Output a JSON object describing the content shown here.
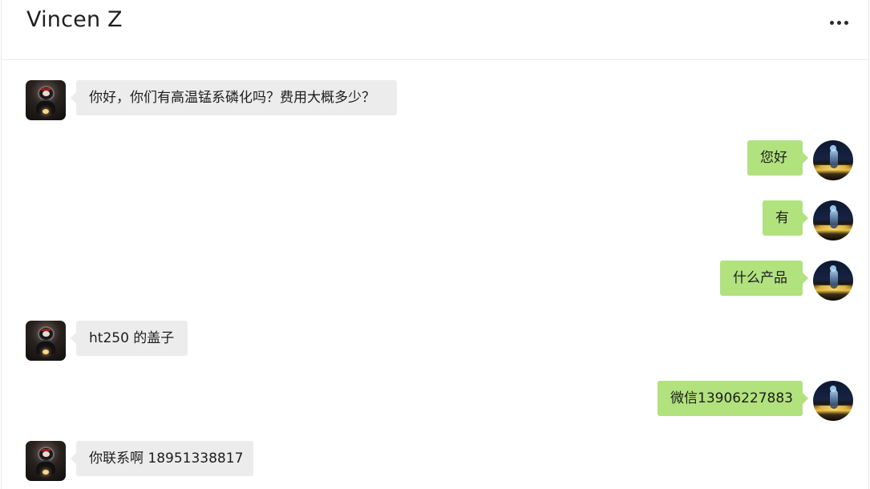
{
  "header": {
    "title": "Vincen Z",
    "more_icon": "more-horizontal-icon"
  },
  "messages": [
    {
      "sender": "incoming",
      "text": "你好，你们有高温锰系磷化吗？费用大概多少？"
    },
    {
      "sender": "outgoing",
      "text": "您好"
    },
    {
      "sender": "outgoing",
      "text": "有"
    },
    {
      "sender": "outgoing",
      "text": "什么产品"
    },
    {
      "sender": "incoming",
      "text": "ht250 的盖子"
    },
    {
      "sender": "outgoing",
      "text": "微信13906227883"
    },
    {
      "sender": "incoming",
      "text": "你联系啊 18951338817"
    }
  ],
  "colors": {
    "incoming_bubble": "#ececec",
    "outgoing_bubble": "#b1e27e",
    "divider": "#e9e9e9"
  }
}
